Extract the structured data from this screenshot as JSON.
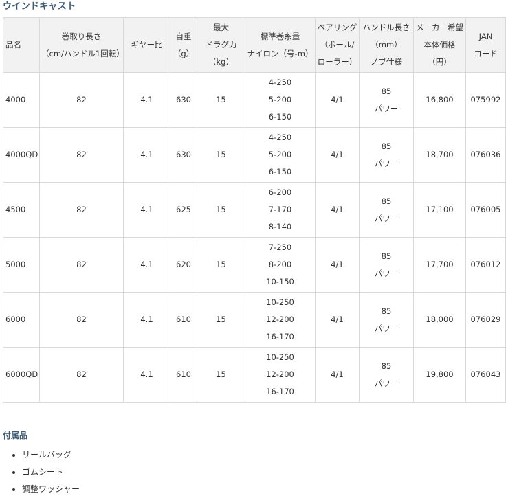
{
  "title": "ウインドキャスト",
  "table": {
    "headers": [
      {
        "lines": [
          "品名"
        ]
      },
      {
        "lines": [
          "巻取り長さ",
          "（cm/ハンドル1回転）"
        ]
      },
      {
        "lines": [
          "ギヤー比"
        ]
      },
      {
        "lines": [
          "自重",
          "（g）"
        ]
      },
      {
        "lines": [
          "最大",
          "ドラグ力",
          "（kg）"
        ]
      },
      {
        "lines": [
          "標準巻糸量",
          "ナイロン（号-m）"
        ]
      },
      {
        "lines": [
          "ベアリング",
          "（ボール/",
          "ローラー）"
        ]
      },
      {
        "lines": [
          "ハンドル長さ",
          "（mm）",
          "ノブ仕様"
        ]
      },
      {
        "lines": [
          "メーカー希望",
          "本体価格",
          "（円）"
        ]
      },
      {
        "lines": [
          "JAN",
          "コード"
        ]
      }
    ],
    "rows": [
      {
        "name": "4000",
        "winding": "82",
        "gear": "4.1",
        "weight": "630",
        "drag": "15",
        "line": [
          "4-250",
          "5-200",
          "6-150"
        ],
        "bearing": "4/1",
        "handle": [
          "85",
          "パワー"
        ],
        "price": "16,800",
        "jan": "075992"
      },
      {
        "name": "4000QD",
        "winding": "82",
        "gear": "4.1",
        "weight": "630",
        "drag": "15",
        "line": [
          "4-250",
          "5-200",
          "6-150"
        ],
        "bearing": "4/1",
        "handle": [
          "85",
          "パワー"
        ],
        "price": "18,700",
        "jan": "076036"
      },
      {
        "name": "4500",
        "winding": "82",
        "gear": "4.1",
        "weight": "625",
        "drag": "15",
        "line": [
          "6-200",
          "7-170",
          "8-140"
        ],
        "bearing": "4/1",
        "handle": [
          "85",
          "パワー"
        ],
        "price": "17,100",
        "jan": "076005"
      },
      {
        "name": "5000",
        "winding": "82",
        "gear": "4.1",
        "weight": "620",
        "drag": "15",
        "line": [
          "7-250",
          "8-200",
          "10-150"
        ],
        "bearing": "4/1",
        "handle": [
          "85",
          "パワー"
        ],
        "price": "17,700",
        "jan": "076012"
      },
      {
        "name": "6000",
        "winding": "82",
        "gear": "4.1",
        "weight": "610",
        "drag": "15",
        "line": [
          "10-250",
          "12-200",
          "16-170"
        ],
        "bearing": "4/1",
        "handle": [
          "85",
          "パワー"
        ],
        "price": "18,000",
        "jan": "076029"
      },
      {
        "name": "6000QD",
        "winding": "82",
        "gear": "4.1",
        "weight": "610",
        "drag": "15",
        "line": [
          "10-250",
          "12-200",
          "16-170"
        ],
        "bearing": "4/1",
        "handle": [
          "85",
          "パワー"
        ],
        "price": "19,800",
        "jan": "076043"
      }
    ]
  },
  "accessories": {
    "title": "付属品",
    "items": [
      "リールバッグ",
      "ゴムシート",
      "調整ワッシャー"
    ]
  }
}
